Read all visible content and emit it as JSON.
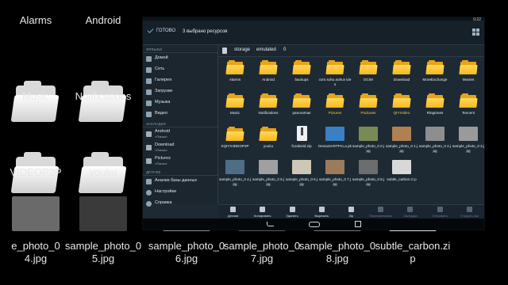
{
  "background": {
    "items": [
      {
        "label": "Alarms",
        "kind": "folder"
      },
      {
        "label": "Android",
        "kind": "folder"
      },
      {
        "label": "Music",
        "kind": "folder"
      },
      {
        "label": "Notifications",
        "kind": "folder"
      },
      {
        "label": "VIDEOP2P",
        "kind": "folder"
      },
      {
        "label": "youku",
        "kind": "folder"
      },
      {
        "label": "e_photo_0\n4.jpg",
        "kind": "image"
      },
      {
        "label": "sample_photo_0\n5.jpg",
        "kind": "image"
      },
      {
        "label": "sample_photo_0\n6.jpg",
        "kind": "image"
      },
      {
        "label": "sample_photo_0\n7.jpg",
        "kind": "image"
      },
      {
        "label": "sample_photo_0\n8.jpg",
        "kind": "image"
      },
      {
        "label": "subtle_carbon.zi\np",
        "kind": "image"
      }
    ]
  },
  "status": {
    "time": "0:22"
  },
  "actionbar": {
    "done_label": "ГОТОВО",
    "selection_text": "3 выбрано ресурсов"
  },
  "sidebar": {
    "libraries_header": "ЯРЛЫКИ",
    "libraries": [
      {
        "label": "Домой",
        "icon": "home-icon"
      },
      {
        "label": "Сеть",
        "icon": "network-icon"
      },
      {
        "label": "Галерея",
        "icon": "gallery-icon"
      },
      {
        "label": "Загрузки",
        "icon": "download-icon"
      },
      {
        "label": "Музыка",
        "icon": "music-icon"
      },
      {
        "label": "Видео",
        "icon": "video-icon"
      }
    ],
    "bookmarks_header": "ЗАКЛАДКИ",
    "bookmarks": [
      {
        "label": "Android",
        "sub": "<Папка>",
        "icon": "folder-icon"
      },
      {
        "label": "Download",
        "sub": "<Папка>",
        "icon": "folder-icon"
      },
      {
        "label": "Pictures",
        "sub": "<Папка>",
        "icon": "folder-icon"
      }
    ],
    "other_header": "ДРУГИЕ",
    "other": [
      {
        "label": "Анализ базы данных",
        "icon": "chart-icon"
      },
      {
        "label": "Настройки",
        "icon": "settings-icon"
      },
      {
        "label": "Справка",
        "icon": "help-icon"
      }
    ]
  },
  "pathbar": {
    "crumbs": [
      "storage",
      "emulated",
      "0"
    ]
  },
  "files": [
    {
      "name": "Alarms",
      "kind": "folder"
    },
    {
      "name": "Android",
      "kind": "folder"
    },
    {
      "name": "backups",
      "kind": "folder"
    },
    {
      "name": "com.sohu.sohuv ideo",
      "kind": "folder"
    },
    {
      "name": "DCIM",
      "kind": "folder"
    },
    {
      "name": "Download",
      "kind": "folder"
    },
    {
      "name": "MoreExchange",
      "kind": "folder"
    },
    {
      "name": "Movies",
      "kind": "folder"
    },
    {
      "name": "Music",
      "kind": "folder"
    },
    {
      "name": "Notifications",
      "kind": "folder"
    },
    {
      "name": "panoramas",
      "kind": "folder"
    },
    {
      "name": "Pictures",
      "kind": "folder",
      "selected": true
    },
    {
      "name": "Podcasts",
      "kind": "folder",
      "selected": true
    },
    {
      "name": "QIYIVideo",
      "kind": "folder",
      "selected": true
    },
    {
      "name": "Ringtones",
      "kind": "folder"
    },
    {
      "name": "Tencent",
      "kind": "folder"
    },
    {
      "name": "XQIYIVIDEOP2P",
      "kind": "folder"
    },
    {
      "name": "youku",
      "kind": "folder"
    },
    {
      "name": "fcookieid.zip",
      "kind": "zip"
    },
    {
      "name": "DeviantARTPro.a pk",
      "kind": "apk",
      "color": "#3b7fc4"
    },
    {
      "name": "sample_photo_0 0.jpg",
      "kind": "image",
      "color": "#7a8a55"
    },
    {
      "name": "sample_photo_0 1.jpg",
      "kind": "image",
      "color": "#b08050"
    },
    {
      "name": "sample_photo_0 2.jpg",
      "kind": "image",
      "color": "#8e8e8e"
    },
    {
      "name": "sample_photo_0 3.jpg",
      "kind": "image",
      "color": "#9a9a9a"
    },
    {
      "name": "sample_photo_0 4.jpg",
      "kind": "image",
      "color": "#4d6f86"
    },
    {
      "name": "sample_photo_0 5.jpg",
      "kind": "image",
      "color": "#a0a0a0"
    },
    {
      "name": "sample_photo_0 6.jpg",
      "kind": "image",
      "color": "#cfc7b6"
    },
    {
      "name": "sample_photo_0 7.jpg",
      "kind": "image",
      "color": "#9c7b5b"
    },
    {
      "name": "sample_photo_0 8.jpg",
      "kind": "image",
      "color": "#6d6d6d"
    },
    {
      "name": "subtle_carbon.zi p",
      "kind": "image",
      "color": "#d8d8d8"
    }
  ],
  "bottombar": [
    {
      "label": "Детали",
      "icon": "details-icon",
      "enabled": true
    },
    {
      "label": "Копировать",
      "icon": "copy-icon",
      "enabled": true
    },
    {
      "label": "Удалить",
      "icon": "delete-icon",
      "enabled": true
    },
    {
      "label": "Вырезать",
      "icon": "cut-icon",
      "enabled": true
    },
    {
      "label": "Zip",
      "icon": "zip-icon",
      "enabled": true
    },
    {
      "label": "Переименовать",
      "icon": "rename-icon",
      "enabled": false
    },
    {
      "label": "Закладка",
      "icon": "bookmark-icon",
      "enabled": false
    },
    {
      "label": "Отправить",
      "icon": "share-icon",
      "enabled": false
    },
    {
      "label": "Открыть как",
      "icon": "open-with-icon",
      "enabled": false
    }
  ]
}
